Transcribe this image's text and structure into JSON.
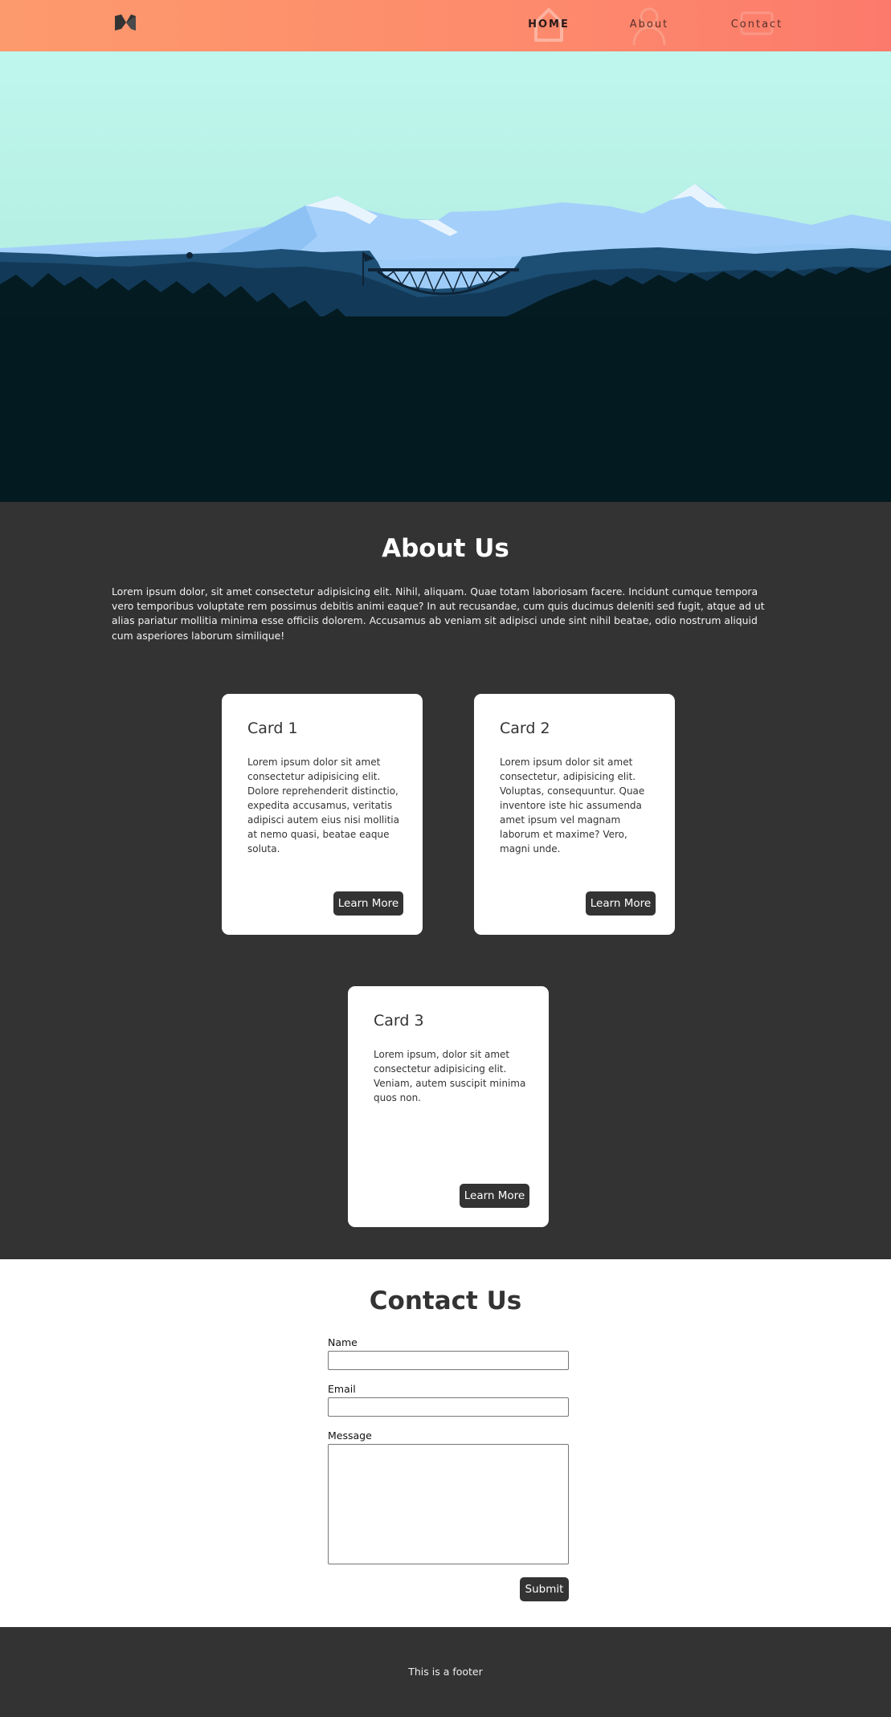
{
  "nav": {
    "logo_icon": "logo-icon",
    "items": [
      {
        "label": "HOME",
        "icon": "home-icon"
      },
      {
        "label": "About",
        "icon": "user-icon"
      },
      {
        "label": "Contact",
        "icon": "mail-icon"
      }
    ],
    "accent_start": "#fd9a6d",
    "accent_end": "#fc7a6c"
  },
  "hero": {
    "icon": "mountain-landscape-illustration"
  },
  "about": {
    "title": "About Us",
    "text": "Lorem ipsum dolor, sit amet consectetur adipisicing elit. Nihil, aliquam. Quae totam laboriosam facere. Incidunt cumque tempora vero temporibus voluptate rem possimus debitis animi eaque? In aut recusandae, cum quis ducimus deleniti sed fugit, atque ad ut alias pariatur mollitia minima esse officiis dolorem. Accusamus ab veniam sit adipisci unde sint nihil beatae, odio nostrum aliquid cum asperiores laborum similique!",
    "cards": [
      {
        "title": "Card 1",
        "text": "Lorem ipsum dolor sit amet consectetur adipisicing elit. Dolore reprehenderit distinctio, expedita accusamus, veritatis adipisci autem eius nisi mollitia at nemo quasi, beatae eaque soluta.",
        "button": "Learn More"
      },
      {
        "title": "Card 2",
        "text": "Lorem ipsum dolor sit amet consectetur, adipisicing elit. Voluptas, consequuntur. Quae inventore iste hic assumenda amet ipsum vel magnam laborum et maxime? Vero, magni unde.",
        "button": "Learn More"
      },
      {
        "title": "Card 3",
        "text": "Lorem ipsum, dolor sit amet consectetur adipisicing elit. Veniam, autem suscipit minima quos non.",
        "button": "Learn More"
      }
    ]
  },
  "contact": {
    "title": "Contact Us",
    "name_label": "Name",
    "name_value": "",
    "email_label": "Email",
    "email_value": "",
    "message_label": "Message",
    "message_value": "",
    "submit": "Submit"
  },
  "footer": {
    "text": "This is a footer"
  }
}
